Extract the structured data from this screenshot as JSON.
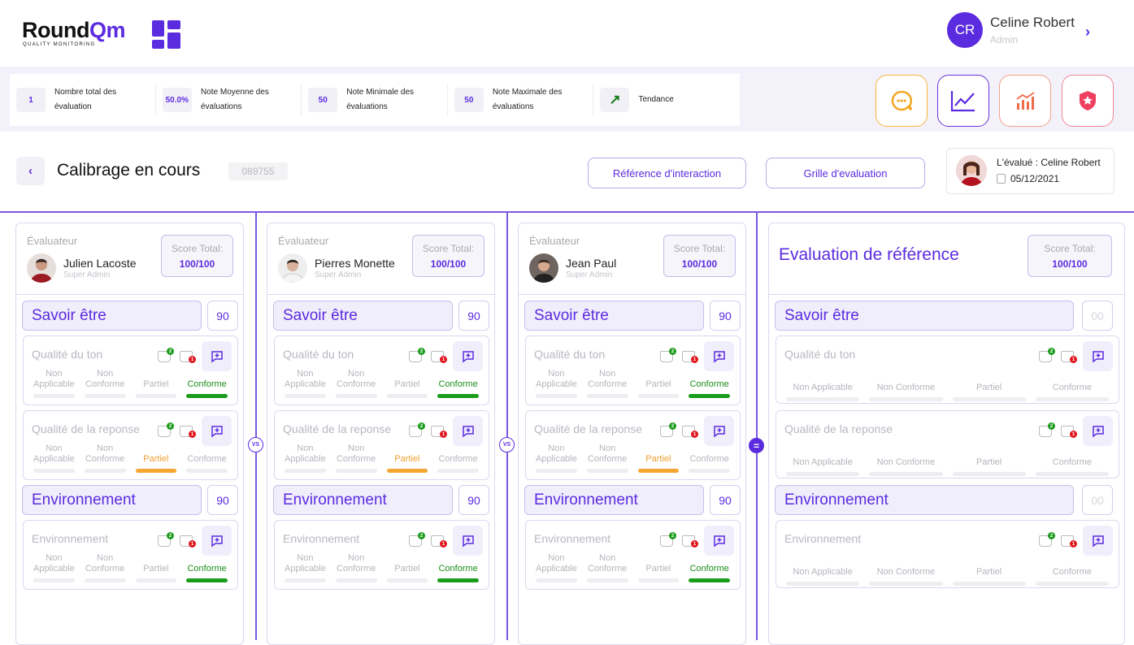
{
  "app": {
    "logo_text": "RoundQm",
    "logo_tagline": "QUALITY MONITORING"
  },
  "user": {
    "initials": "CR",
    "name": "Celine Robert",
    "role": "Admin"
  },
  "stats": [
    {
      "value": "1",
      "label": "Nombre total des évaluation"
    },
    {
      "value": "50.0%",
      "label": "Note Moyenne des évaluations"
    },
    {
      "value": "50",
      "label": "Note Minimale des évaluations"
    },
    {
      "value": "50",
      "label": "Note Maximale des évaluations"
    },
    {
      "value": "↗",
      "label": "Tendance"
    }
  ],
  "action_icons": [
    "chat-bubble-icon",
    "line-chart-icon",
    "bar-chart-icon",
    "shield-star-icon"
  ],
  "header": {
    "title": "Calibrage en cours",
    "code": "089755",
    "btn_reference": "Référence d'interaction",
    "btn_grille": "Grille d'evaluation",
    "evalue_label": "L'évalué : Celine Robert",
    "evalue_date": "05/12/2021"
  },
  "columns": [
    {
      "label": "Évaluateur",
      "name": "Julien Lacoste",
      "role": "Super Admin",
      "score_label": "Score Total:",
      "score": "100/100"
    },
    {
      "label": "Évaluateur",
      "name": "Pierres Monette",
      "role": "Super Admin",
      "score_label": "Score Total:",
      "score": "100/100"
    },
    {
      "label": "Évaluateur",
      "name": "Jean Paul",
      "role": "Super Admin",
      "score_label": "Score Total:",
      "score": "100/100"
    },
    {
      "title": "Evaluation de référence",
      "score_label": "Score Total:",
      "score": "100/100"
    }
  ],
  "sections": {
    "savoir": "Savoir être",
    "env": "Environnement"
  },
  "section_scores": [
    "90",
    "90",
    "90",
    "00"
  ],
  "criteria": {
    "ton": "Qualité du ton",
    "reponse": "Qualité de la reponse",
    "env": "Environnement"
  },
  "thumb_counts": {
    "up": "2",
    "down": "1"
  },
  "options_short": [
    "Non Applicable",
    "Non Conforme",
    "Partiel",
    "Conforme"
  ],
  "options_long": [
    "Non Applicable",
    "Non Conforme",
    "Partiel",
    "Conforme"
  ],
  "separators": {
    "vs": "VS",
    "eq": "="
  },
  "colors": {
    "accent": "#5b2be0",
    "green": "#1c9c1c",
    "orange": "#f5a632",
    "red": "#e0161c"
  }
}
